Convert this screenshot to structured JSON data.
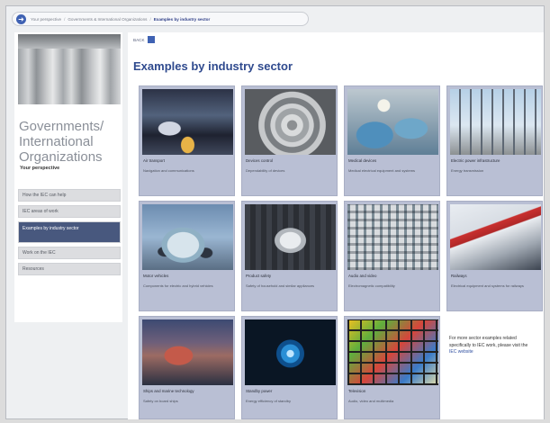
{
  "breadcrumb": {
    "items": [
      "Your perspective",
      "Governments & International Organizations",
      "Examples by industry sector"
    ]
  },
  "sidebar": {
    "title": "Governments/ International Organizations",
    "subtitle": "Your perspective",
    "nav": [
      {
        "label": "How the IEC can help",
        "active": false
      },
      {
        "label": "IEC areas of work",
        "active": false
      },
      {
        "label": "Examples by industry sector",
        "active": true
      },
      {
        "label": "Work on the IEC",
        "active": false
      },
      {
        "label": "Resources",
        "active": false
      }
    ]
  },
  "main": {
    "back_label": "BACK",
    "title": "Examples by industry sector",
    "cards": [
      {
        "title": "Air transport",
        "desc": "Navigation and communications"
      },
      {
        "title": "Devices control",
        "desc": "Dependability of devices"
      },
      {
        "title": "Medical devices",
        "desc": "Medical electrical equipment and systems"
      },
      {
        "title": "Electric power infrastructure",
        "desc": "Energy transmission"
      },
      {
        "title": "Motor vehicles",
        "desc": "Components for electric and hybrid vehicles"
      },
      {
        "title": "Product safety",
        "desc": "Safety of household and similar appliances"
      },
      {
        "title": "Audio and video",
        "desc": "Electromagnetic compatibility"
      },
      {
        "title": "Railways",
        "desc": "Electrical equipment and systems for railways"
      },
      {
        "title": "Ships and marine technology",
        "desc": "Safety on board ships"
      },
      {
        "title": "Standby power",
        "desc": "Energy efficiency of standby"
      },
      {
        "title": "Television",
        "desc": "Audio, video and multimedia"
      }
    ],
    "note": {
      "text": "For more sector examples related specifically to IEC work, please visit the",
      "link": "IEC website"
    }
  },
  "icons": {
    "home": "arrow-right-icon",
    "back": "grid-icon"
  },
  "colors": {
    "accent": "#2f4a8e",
    "nav_active": "#48587e",
    "card_bg": "#b9bfd4"
  }
}
